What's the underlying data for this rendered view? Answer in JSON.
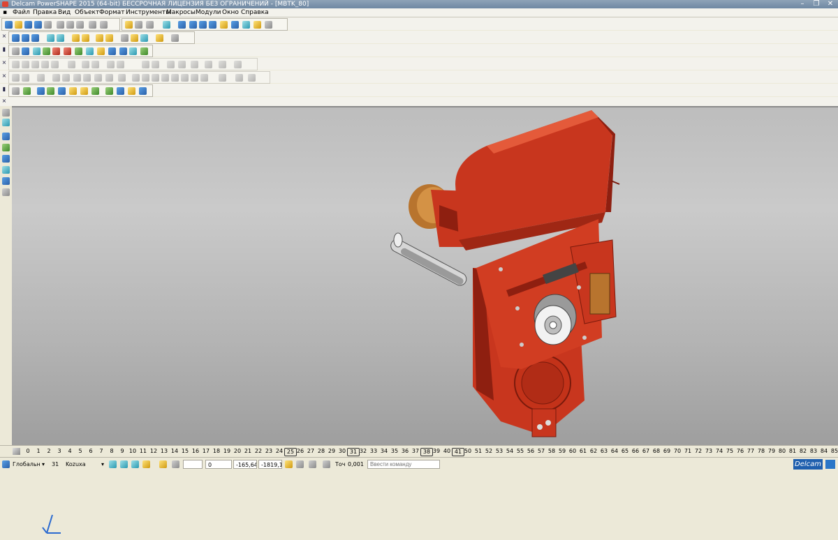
{
  "window": {
    "title": "Delcam PowerSHAPE 2015 (64-bit) БЕССРОЧНАЯ ЛИЦЕНЗИЯ БЕЗ ОГРАНИЧЕНИЙ - [MBTK_80]",
    "minimize": "–",
    "restore": "❐",
    "close": "✕"
  },
  "menu": {
    "items": [
      "Файл",
      "Правка",
      "Вид",
      "Объект",
      "Формат",
      "Инструменты",
      "Макросы",
      "Модули",
      "Окно",
      "Справка"
    ]
  },
  "toolbars": {
    "close_glyph": "×"
  },
  "ruler": {
    "levels": [
      "0",
      "1",
      "2",
      "3",
      "4",
      "5",
      "6",
      "7",
      "8",
      "9",
      "10",
      "11",
      "12",
      "13",
      "14",
      "15",
      "16",
      "17",
      "18",
      "19",
      "20",
      "21",
      "22",
      "23",
      "24",
      "25",
      "26",
      "27",
      "28",
      "29",
      "30",
      "31",
      "32",
      "33",
      "34",
      "35",
      "36",
      "37",
      "38",
      "39",
      "40",
      "41",
      "50",
      "51",
      "52",
      "53",
      "54",
      "55",
      "56",
      "57",
      "58",
      "59",
      "60",
      "61",
      "62",
      "63",
      "64",
      "65",
      "66",
      "67",
      "68",
      "69",
      "70",
      "71",
      "72",
      "73",
      "74",
      "75",
      "76",
      "77",
      "78",
      "79",
      "80",
      "81",
      "82",
      "83",
      "84",
      "85"
    ],
    "boxed": [
      "25",
      "31",
      "38",
      "41"
    ]
  },
  "status": {
    "workplane": "Глобальн",
    "level_number": "31",
    "level_name": "Kozuxa",
    "coord_z": "0",
    "coord_x": "-165,64",
    "coord_y": "-1819,1",
    "tolerance_label": "Точ",
    "tolerance_value": "0,001",
    "command_placeholder": "Ввести команду",
    "brand": "Delcam"
  },
  "colors": {
    "part_red": "#c8361e",
    "part_dark": "#8e1f10",
    "steel": "#cfcfcf",
    "motor_bronze": "#b8742e"
  }
}
